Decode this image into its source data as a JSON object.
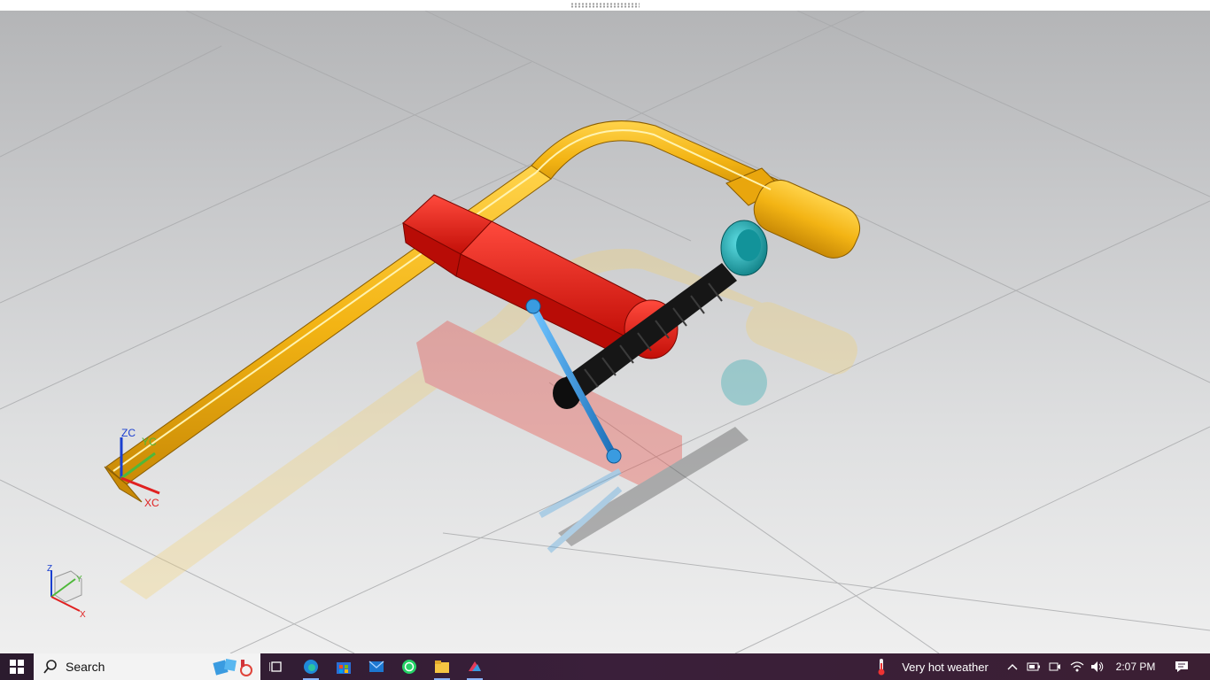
{
  "viewport": {
    "triad": {
      "z": "ZC",
      "y": "YC",
      "x": "XC"
    },
    "view_triad": {
      "z": "Z",
      "y": "Y",
      "x": "X"
    }
  },
  "taskbar": {
    "search_label": "Search",
    "apps": [
      "task-view",
      "edge",
      "microsoft-store",
      "mail",
      "whatsapp",
      "file-explorer",
      "nx"
    ],
    "weather": "Very hot weather",
    "time": "2:07 PM"
  },
  "colors": {
    "frame": "#f3b414",
    "clamp_body": "#ee1b12",
    "handle": "#3a9be0",
    "pad": "#1aa3a9",
    "screw": "#161616"
  }
}
